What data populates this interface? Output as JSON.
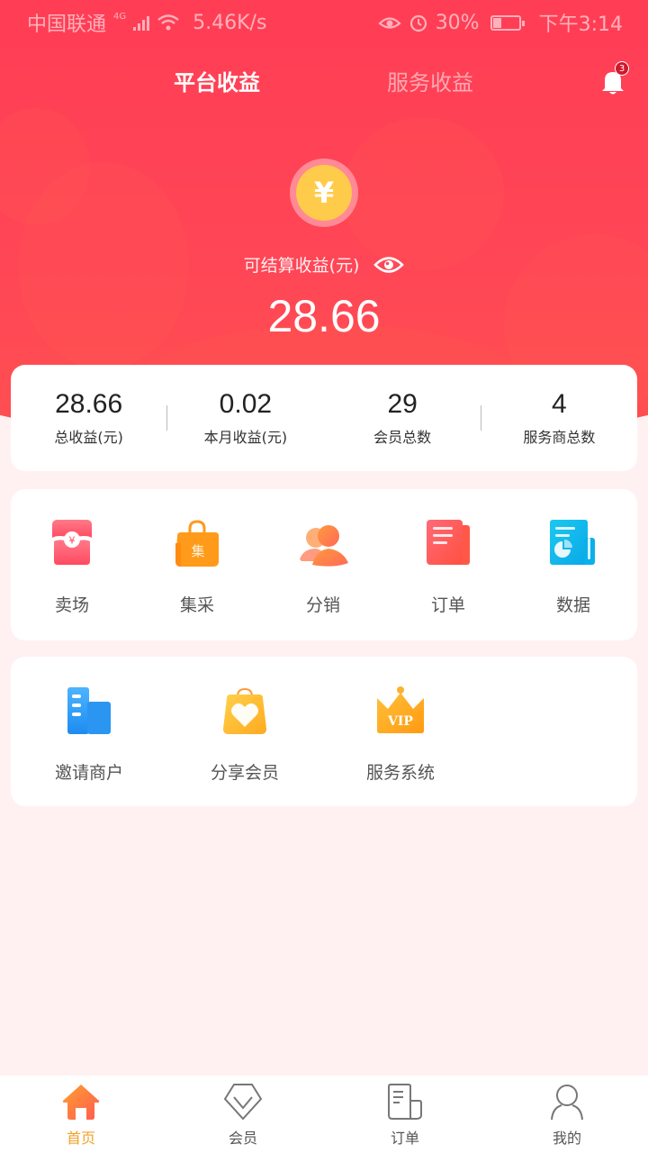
{
  "status_bar": {
    "carrier": "中国联通",
    "network": "4G",
    "speed": "5.46K/s",
    "battery": "30%",
    "time": "下午3:14"
  },
  "header": {
    "tabs": [
      {
        "label": "平台收益",
        "active": true
      },
      {
        "label": "服务收益",
        "active": false
      }
    ],
    "notification_count": "3"
  },
  "balance": {
    "currency_symbol": "¥",
    "label": "可结算收益(元)",
    "amount": "28.66"
  },
  "stats": [
    {
      "value": "28.66",
      "label": "总收益(元)"
    },
    {
      "value": "0.02",
      "label": "本月收益(元)"
    },
    {
      "value": "29",
      "label": "会员总数"
    },
    {
      "value": "4",
      "label": "服务商总数"
    }
  ],
  "menu_row1": [
    {
      "label": "卖场",
      "icon": "store-icon",
      "badge_text": "¥"
    },
    {
      "label": "集采",
      "icon": "shopping-bag-icon",
      "badge_text": "集"
    },
    {
      "label": "分销",
      "icon": "users-icon"
    },
    {
      "label": "订单",
      "icon": "order-icon"
    },
    {
      "label": "数据",
      "icon": "data-report-icon"
    }
  ],
  "menu_row2": [
    {
      "label": "邀请商户",
      "icon": "building-icon"
    },
    {
      "label": "分享会员",
      "icon": "heart-bag-icon"
    },
    {
      "label": "服务系统",
      "icon": "vip-crown-icon",
      "badge_text": "VIP"
    }
  ],
  "tabbar": [
    {
      "label": "首页",
      "icon": "home-icon",
      "active": true
    },
    {
      "label": "会员",
      "icon": "diamond-icon",
      "active": false
    },
    {
      "label": "订单",
      "icon": "document-icon",
      "active": false
    },
    {
      "label": "我的",
      "icon": "user-icon",
      "active": false
    }
  ],
  "colors": {
    "primary": "#ff3d55",
    "coin": "#ffcb4a",
    "active_tab": "#f0a22a",
    "page_bg": "#fff1f2"
  }
}
